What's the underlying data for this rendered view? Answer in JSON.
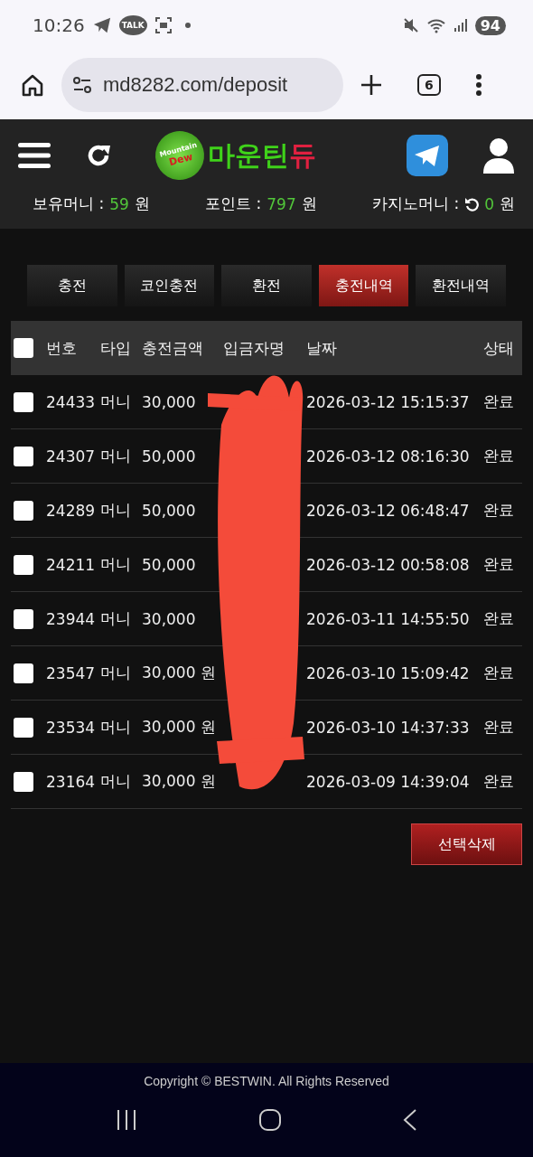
{
  "status_bar": {
    "time": "10:26",
    "talk_badge": "TALK",
    "battery": "94"
  },
  "browser": {
    "url": "md8282.com/deposit",
    "tab_count": "6"
  },
  "header": {
    "logo_badge": [
      "Mountain",
      "Dew"
    ],
    "logo_green": "마운틴",
    "logo_red": "듀"
  },
  "balances": [
    {
      "label": "보유머니 :",
      "value": "59",
      "unit": "원",
      "refresh": false
    },
    {
      "label": "포인트 :",
      "value": "797",
      "unit": "원",
      "refresh": false
    },
    {
      "label": "카지노머니 :",
      "value": "0",
      "unit": "원",
      "refresh": true
    }
  ],
  "tabs": [
    {
      "label": "충전",
      "selected": false
    },
    {
      "label": "코인충전",
      "selected": false
    },
    {
      "label": "환전",
      "selected": false
    },
    {
      "label": "충전내역",
      "selected": true
    },
    {
      "label": "환전내역",
      "selected": false
    }
  ],
  "table": {
    "select_all": false,
    "columns": [
      "번호",
      "타입",
      "충전금액",
      "입금자명",
      "날짜",
      "상태"
    ],
    "rows": [
      {
        "number": "24433",
        "type": "머니",
        "amount": "30,000",
        "date": "2026-03-12 15:15:37",
        "status": "완료",
        "checked": false
      },
      {
        "number": "24307",
        "type": "머니",
        "amount": "50,000",
        "date": "2026-03-12 08:16:30",
        "status": "완료",
        "checked": false
      },
      {
        "number": "24289",
        "type": "머니",
        "amount": "50,000",
        "date": "2026-03-12 06:48:47",
        "status": "완료",
        "checked": false
      },
      {
        "number": "24211",
        "type": "머니",
        "amount": "50,000",
        "date": "2026-03-12 00:58:08",
        "status": "완료",
        "checked": false
      },
      {
        "number": "23944",
        "type": "머니",
        "amount": "30,000",
        "date": "2026-03-11 14:55:50",
        "status": "완료",
        "checked": false
      },
      {
        "number": "23547",
        "type": "머니",
        "amount": "30,000 원",
        "date": "2026-03-10 15:09:42",
        "status": "완료",
        "checked": false
      },
      {
        "number": "23534",
        "type": "머니",
        "amount": "30,000 원",
        "date": "2026-03-10 14:37:33",
        "status": "완료",
        "checked": false
      },
      {
        "number": "23164",
        "type": "머니",
        "amount": "30,000 원",
        "date": "2026-03-09 14:39:04",
        "status": "완료",
        "checked": false
      }
    ]
  },
  "delete_button": "선택삭제",
  "footer": "Copyright © BESTWIN. All Rights Reserved"
}
